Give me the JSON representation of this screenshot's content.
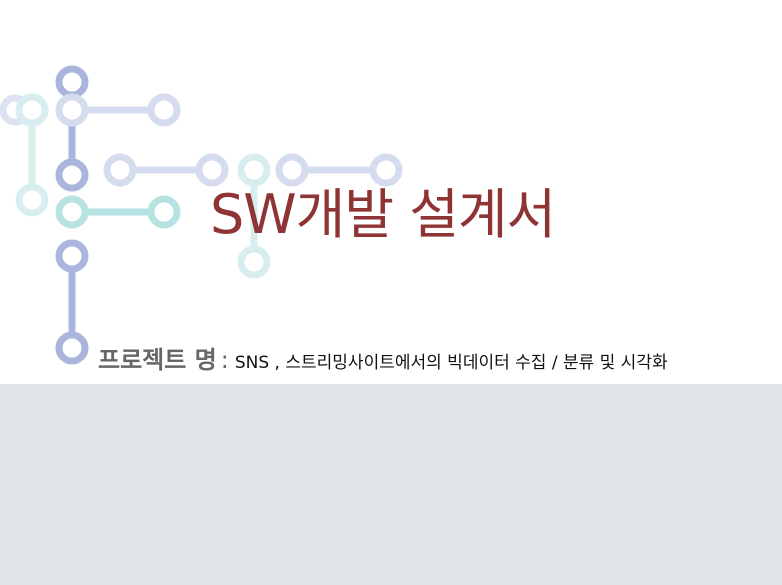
{
  "slide": {
    "title": "SW개발 설계서",
    "project_label": "프로젝트 명",
    "project_colon": ":",
    "project_name": "SNS , 스트리밍사이트에서의 빅데이터 수집 / 분류 및 시각화"
  },
  "colors": {
    "title": "#8f3434",
    "label": "#666666",
    "band": "#e1e4e8",
    "node_blue": "#aab6dc",
    "node_lightblue": "#d4dcef",
    "node_teal": "#b3e0e0",
    "node_paleteal": "#d6ecec"
  }
}
